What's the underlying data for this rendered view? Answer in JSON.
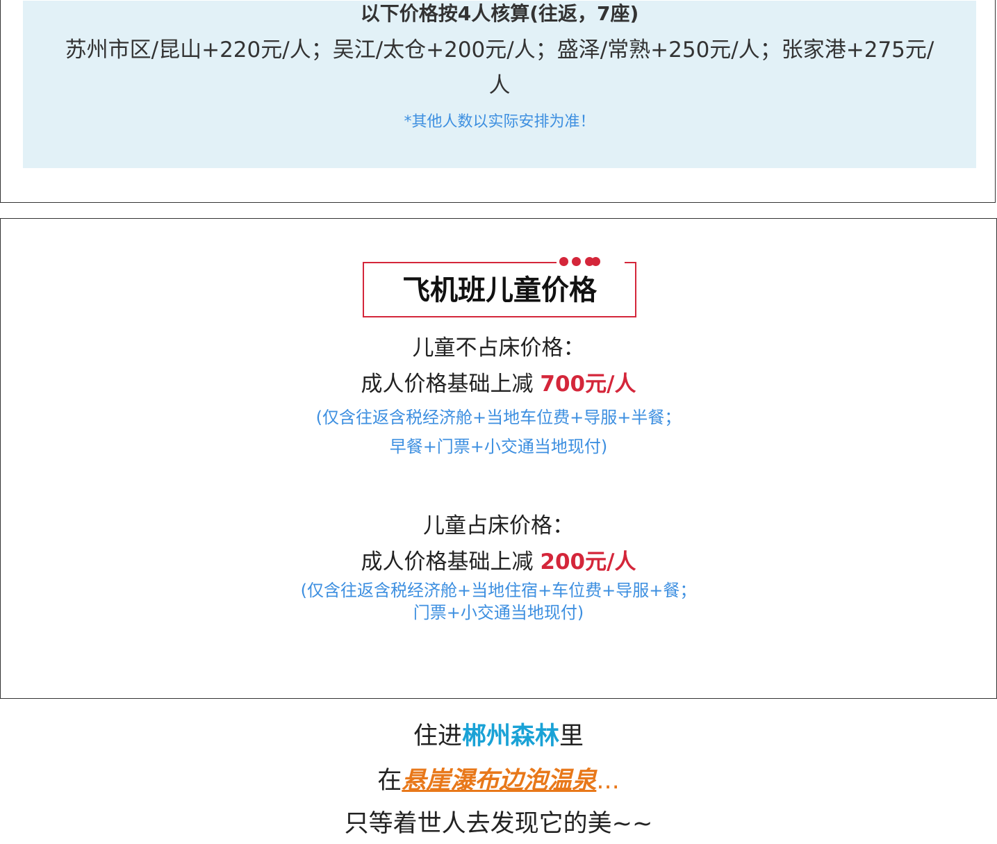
{
  "route_pricing": {
    "title": "以下价格按4人核算(往返，7座)",
    "body": "苏州市区/昆山+220元/人；吴江/太仓+200元/人；盛泽/常熟+250元/人；张家港+275元/人",
    "note": "*其他人数以实际安排为准！"
  },
  "child_price": {
    "heading": "飞机班儿童价格",
    "no_bed": {
      "label": "儿童不占床价格：",
      "line_prefix": "成人价格基础上减 ",
      "amount": "700元/人",
      "note_line1": "(仅含往返含税经济舱+当地车位费+导服+半餐；",
      "note_line2": "早餐+门票+小交通当地现付)"
    },
    "with_bed": {
      "label": "儿童占床价格：",
      "line_prefix": "成人价格基础上减 ",
      "amount": "200元/人",
      "note_line1": "(仅含往返含税经济舱+当地住宿+车位费+导服+餐；",
      "note_line2": "门票+小交通当地现付)"
    }
  },
  "tagline": {
    "line1_prefix": "住进",
    "line1_highlight": "郴州森林",
    "line1_suffix": "里",
    "line2_prefix": "在",
    "line2_highlight": "悬崖瀑布边泡温泉",
    "line2_suffix": "...",
    "line3": "只等着世人去发现它的美~~"
  },
  "colors": {
    "panel_bg": "#e2f1f7",
    "accent_red": "#d4263a",
    "note_blue": "#3d8fe0",
    "highlight_cyan": "#1aa2d6",
    "highlight_orange": "#e8781a"
  }
}
